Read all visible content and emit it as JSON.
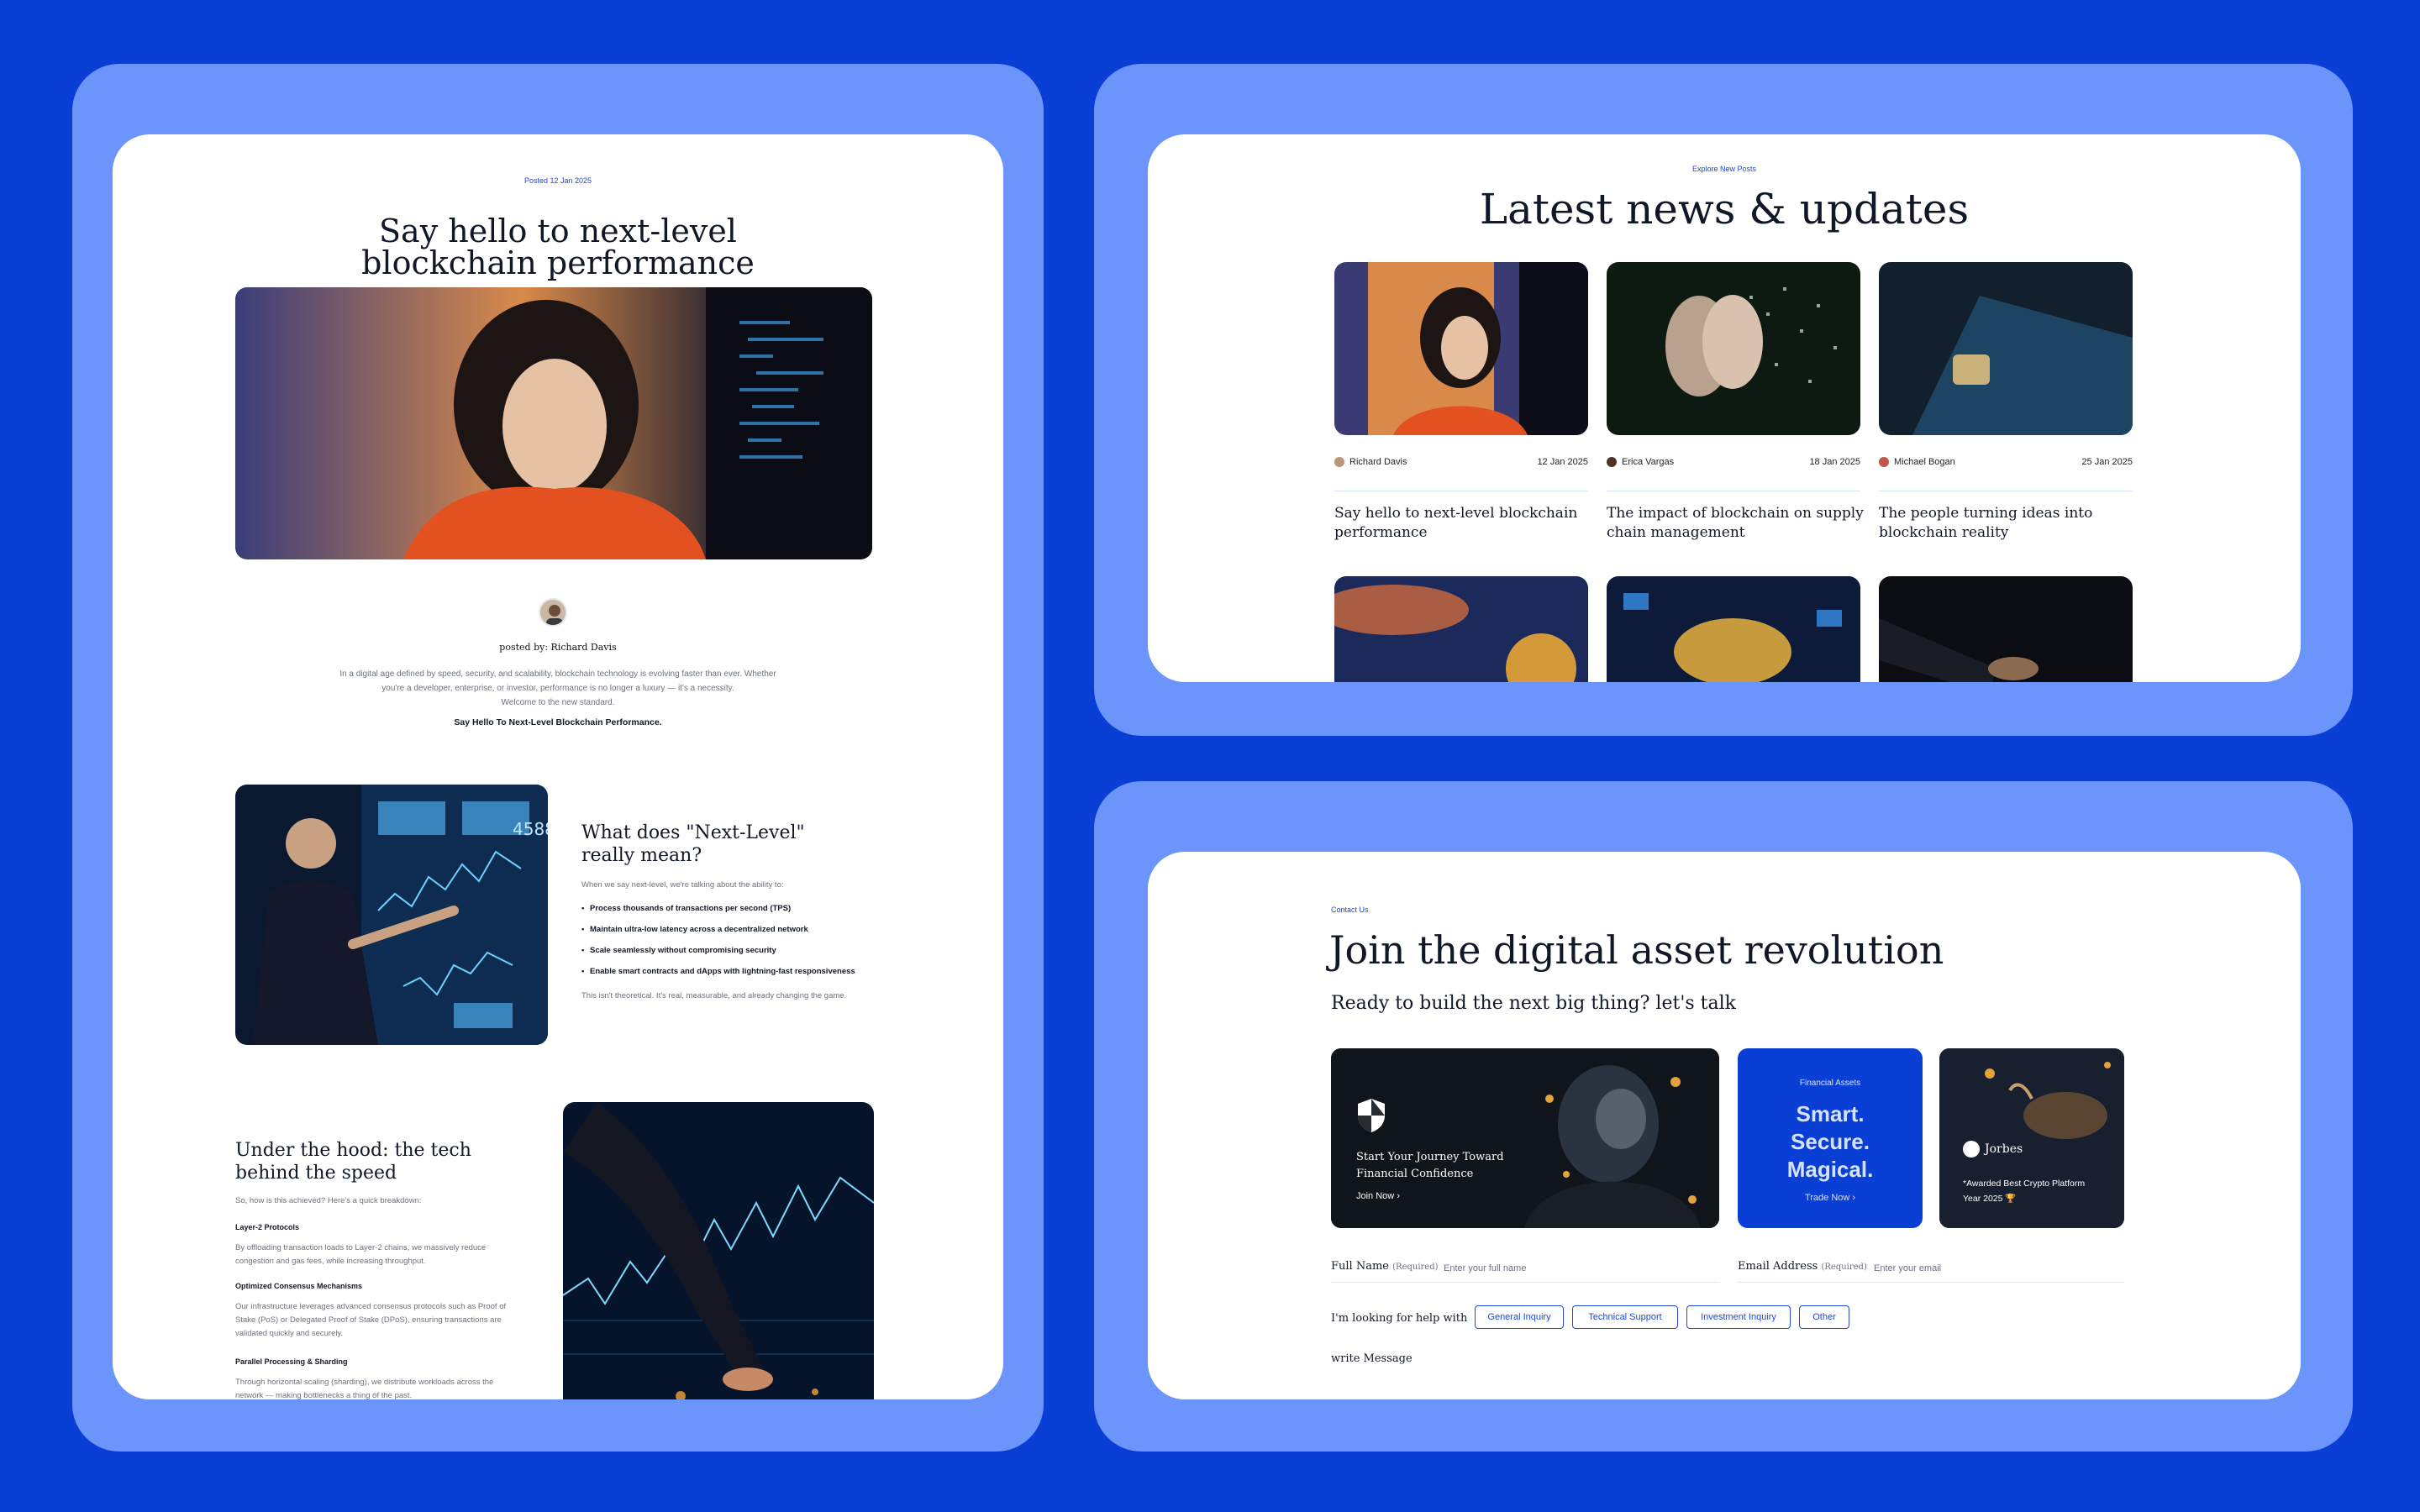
{
  "article": {
    "posted": "Posted 12 Jan 2025",
    "title_line1": "Say hello to next-level",
    "title_line2": "blockchain performance",
    "posted_by": "posted by: Richard Davis",
    "intro_1": "In a digital age defined by speed, security, and scalability, blockchain technology is evolving faster than ever. Whether",
    "intro_2": "you're a developer, enterprise, or investor, performance is no longer a luxury — it's a necessity.",
    "intro_3": "Welcome to the new standard.",
    "intro_bold": "Say Hello To Next-Level Blockchain Performance.",
    "section1": {
      "title_line1": "What does \"Next-Level\"",
      "title_line2": "really mean?",
      "lead": "When we say next-level, we're talking about the ability to:",
      "bullets": [
        "Process thousands of transactions per second (TPS)",
        "Maintain ultra-low latency across a decentralized network",
        "Scale seamlessly without compromising security",
        "Enable smart contracts and dApps with lightning-fast responsiveness"
      ],
      "closing": "This isn't theoretical. It's real, measurable, and already changing the game."
    },
    "section2": {
      "title_line1": "Under the hood: the tech",
      "title_line2": "behind the speed",
      "lead": "So, how is this achieved? Here's a quick breakdown:",
      "h_layer2": "Layer-2 Protocols",
      "p_layer2_1": "By offloading transaction loads to Layer-2 chains, we massively reduce",
      "p_layer2_2": "congestion and gas fees, while increasing throughput.",
      "h_consensus": "Optimized Consensus Mechanisms",
      "p_consensus_1": "Our infrastructure leverages advanced consensus protocols such as Proof of",
      "p_consensus_2": "Stake (PoS) or Delegated Proof of Stake (DPoS), ensuring transactions are",
      "p_consensus_3": "validated quickly and securely.",
      "h_parallel": "Parallel Processing & Sharding",
      "p_parallel_1": "Through horizontal scaling (sharding), we distribute workloads across the",
      "p_parallel_2": "network — making bottlenecks a thing of the past."
    }
  },
  "news": {
    "eyebrow": "Explore New Posts",
    "title": "Latest news & updates",
    "posts": [
      {
        "author": "Richard Davis",
        "date": "12 Jan 2025",
        "title_line1": "Say hello to next-level blockchain",
        "title_line2": "performance"
      },
      {
        "author": "Erica Vargas",
        "date": "18 Jan 2025",
        "title_line1": "The impact of blockchain on supply",
        "title_line2": "chain management"
      },
      {
        "author": "Michael Bogan",
        "date": "25 Jan 2025",
        "title_line1": "The people turning ideas into",
        "title_line2": "blockchain reality"
      }
    ]
  },
  "contact": {
    "eyebrow": "Contact Us",
    "title": "Join the digital asset revolution",
    "subtitle": "Ready to build the next big thing? let's talk",
    "tile1": {
      "text_line1": "Start Your Journey Toward",
      "text_line2": "Financial Confidence",
      "link": "Join Now"
    },
    "tile2": {
      "eyebrow": "Financial Assets",
      "line1": "Smart.",
      "line2": "Secure.",
      "line3": "Magical.",
      "link": "Trade Now"
    },
    "tile3": {
      "brand": "Jorbes",
      "text_line1": "*Awarded Best Crypto Platform",
      "text_line2": "Year 2025 🏆"
    },
    "full_name_label": "Full Name",
    "full_name_req": "(Required)",
    "full_name_placeholder": "Enter your full name",
    "email_label": "Email Address",
    "email_req": "(Required)",
    "email_placeholder": "Enter your email",
    "looking_label": "I'm looking for help with",
    "chips": [
      "General Inquiry",
      "Technical Support",
      "Investment Inquiry",
      "Other"
    ],
    "message_label": "write Message"
  },
  "colors": {
    "background": "#0A3FD6",
    "frame": "#6B95FB",
    "accent": "#1F49D6"
  }
}
